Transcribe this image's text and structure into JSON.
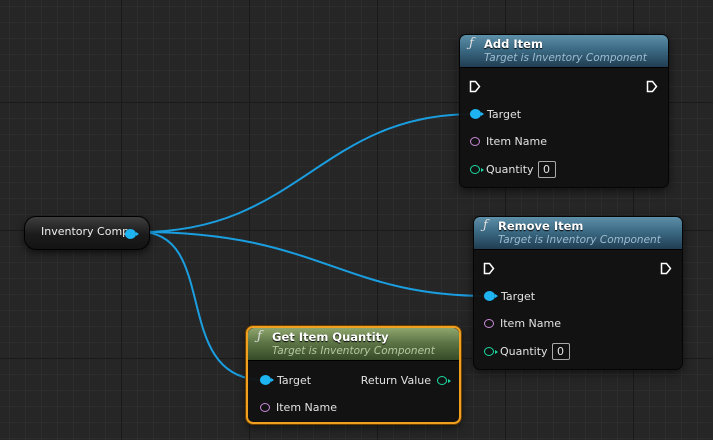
{
  "variable_node": {
    "label": "Inventory Comp"
  },
  "nodes": {
    "add_item": {
      "glyph": "ƒ",
      "title": "Add Item",
      "subtitle": "Target is Inventory Component",
      "pins": {
        "target": "Target",
        "item_name": "Item Name",
        "quantity": "Quantity"
      },
      "quantity_value": "0"
    },
    "remove_item": {
      "glyph": "ƒ",
      "title": "Remove Item",
      "subtitle": "Target is Inventory Component",
      "pins": {
        "target": "Target",
        "item_name": "Item Name",
        "quantity": "Quantity"
      },
      "quantity_value": "0"
    },
    "get_item_quantity": {
      "glyph": "ƒ",
      "title": "Get Item Quantity",
      "subtitle": "Target is Inventory Component",
      "pins": {
        "target": "Target",
        "item_name": "Item Name",
        "return_value": "Return Value"
      }
    }
  },
  "colors": {
    "object_pin": "#1eb4f2",
    "name_pin": "#c98ad9",
    "integer_pin": "#1bd9a0",
    "exec_pin": "#ffffff",
    "selection": "#f0a01e",
    "function_header": "#3c6a84",
    "pure_function_header": "#5d7546",
    "wire": "#1a9ee0"
  },
  "icons": {
    "function": "function-f-icon",
    "exec": "exec-arrow-icon",
    "object": "object-pin-icon",
    "name": "name-pin-icon",
    "integer": "integer-pin-icon"
  }
}
